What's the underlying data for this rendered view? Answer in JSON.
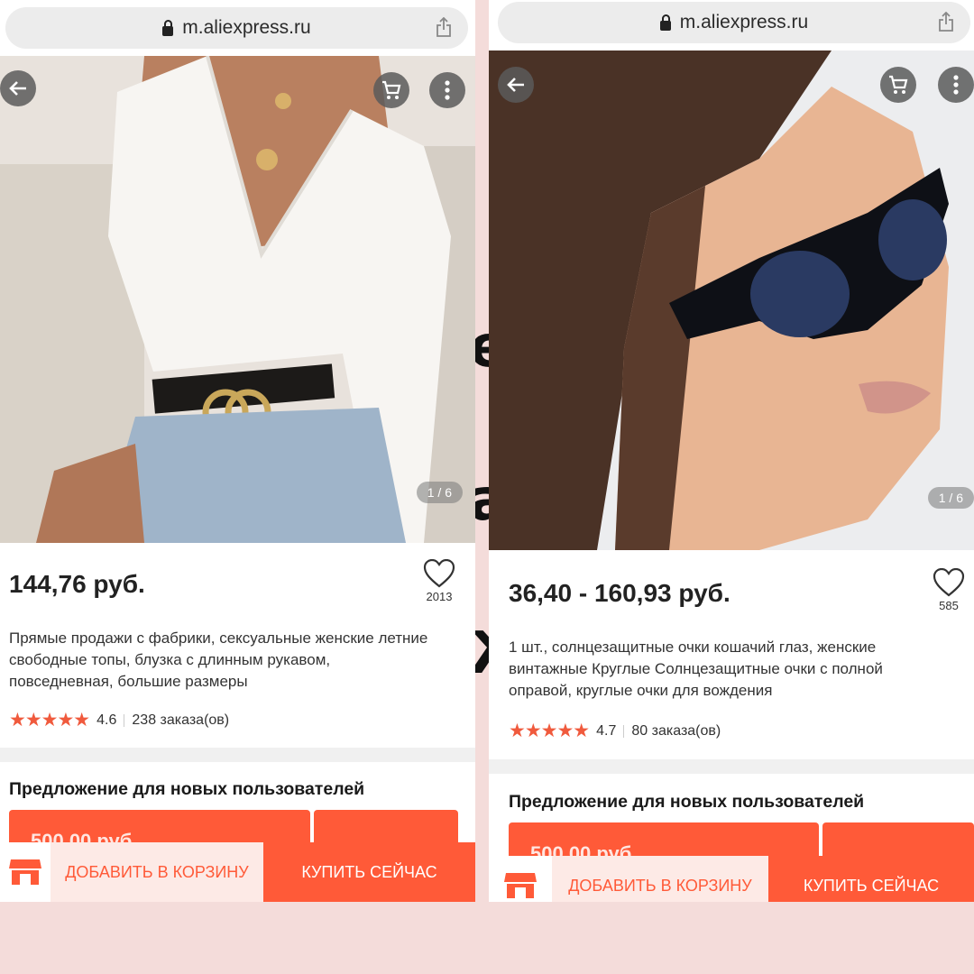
{
  "colors": {
    "background": "#f4dcda",
    "accent": "#ff5a38",
    "rating": "#f05a3d"
  },
  "left": {
    "url": "m.aliexpress.ru",
    "image_counter": "1 / 6",
    "price": "144,76 руб.",
    "favorites_count": "2013",
    "title": "Прямые продажи с фабрики, сексуальные женские летние свободные топы, блузка с длинным рукавом, повседневная, большие размеры",
    "rating_stars": "★★★★★",
    "rating_value": "4.6",
    "orders": "238 заказа(ов)",
    "promo_title": "Предложение для новых пользователей",
    "coupon_text": "500,00 руб.",
    "add_to_cart": "ДОБАВИТЬ В КОРЗИНУ",
    "buy_now": "КУПИТЬ СЕЙЧАС"
  },
  "right": {
    "url": "m.aliexpress.ru",
    "image_counter": "1 / 6",
    "price": "36,40 - 160,93 руб.",
    "favorites_count": "585",
    "title": "1 шт., солнцезащитные очки кошачий глаз, женские винтажные Круглые Солнцезащитные очки с полной оправой, круглые очки для вождения",
    "rating_stars": "★★★★★",
    "rating_value": "4.7",
    "orders": "80 заказа(ов)",
    "promo_title": "Предложение для новых пользователей",
    "coupon_text": "500,00 руб.",
    "add_to_cart": "ДОБАВИТЬ В КОРЗИНУ",
    "buy_now": "КУПИТЬ СЕЙЧАС"
  },
  "icons": [
    "lock-icon",
    "share-icon",
    "back-arrow-icon",
    "cart-icon",
    "more-icon",
    "heart-icon",
    "star-icon",
    "store-icon"
  ]
}
